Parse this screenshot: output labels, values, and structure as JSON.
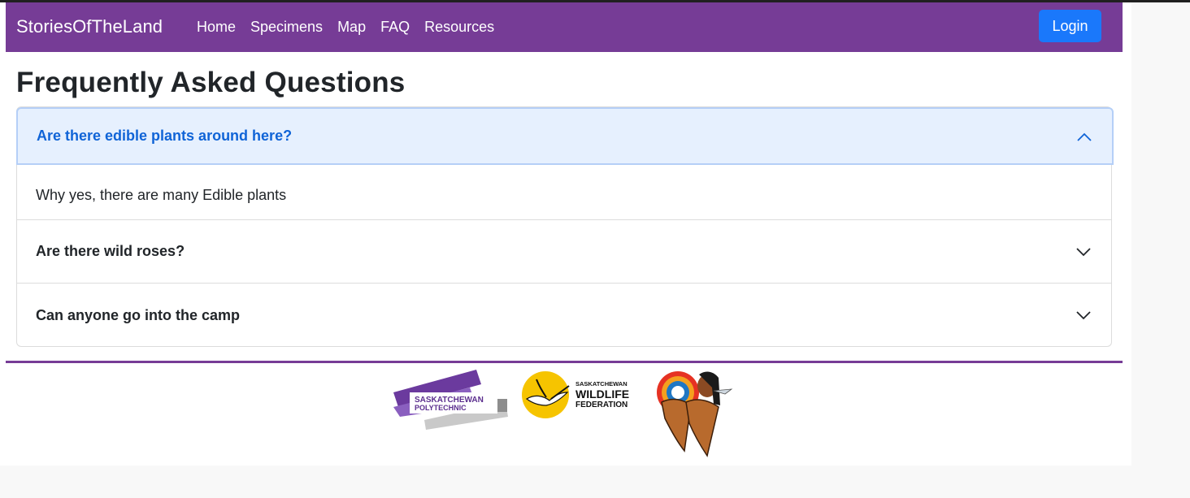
{
  "navbar": {
    "brand": "StoriesOfTheLand",
    "links": [
      "Home",
      "Specimens",
      "Map",
      "FAQ",
      "Resources"
    ],
    "login_label": "Login"
  },
  "page": {
    "title": "Frequently Asked Questions"
  },
  "faq": {
    "items": [
      {
        "question": "Are there edible plants around here?",
        "answer": "Why yes, there are many Edible plants",
        "expanded": true
      },
      {
        "question": "Are there wild roses?",
        "expanded": false
      },
      {
        "question": "Can anyone go into the camp",
        "expanded": false
      }
    ]
  },
  "footer": {
    "logos": {
      "polytechnic": {
        "line1": "SASKATCHEWAN",
        "line2": "POLYTECHNIC"
      },
      "wildlife": {
        "line1": "SASKATCHEWAN",
        "line2": "WILDLIFE",
        "line3": "FEDERATION"
      },
      "third": {
        "icon": "indigenous-emblem"
      }
    }
  },
  "colors": {
    "navbar": "#763c96",
    "login_button": "#1a78fb",
    "accordion_active_bg": "#e6f0fe",
    "accordion_active_text": "#1064d7"
  }
}
